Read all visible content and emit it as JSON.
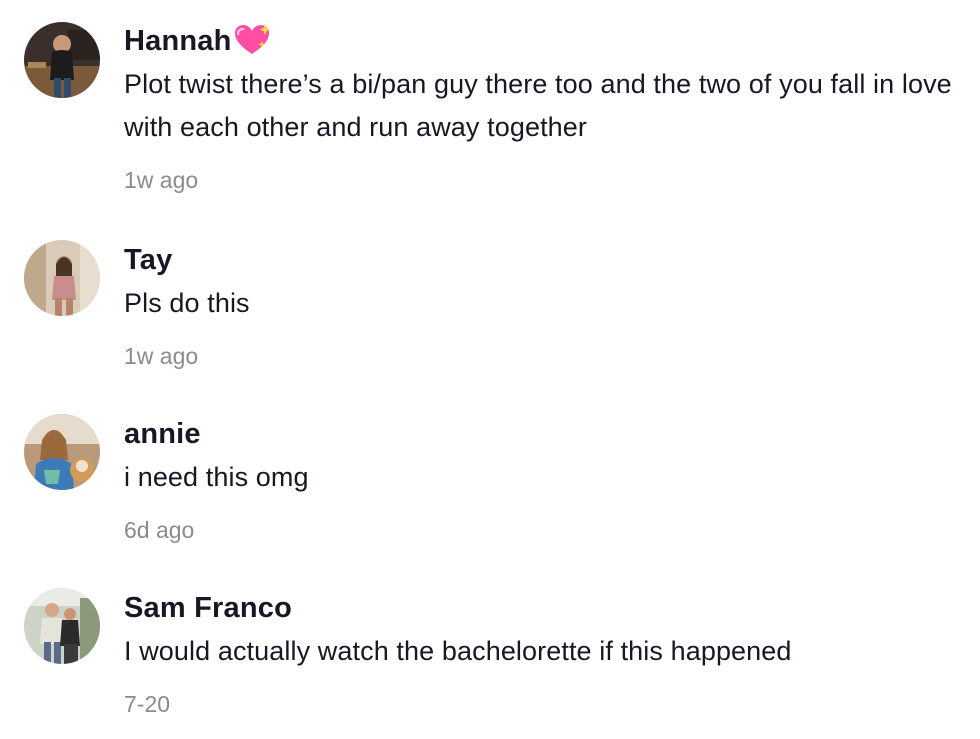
{
  "comments": [
    {
      "username": "Hannah",
      "emoji_icon": "sparkling-heart-icon",
      "text": "Plot twist there’s a bi/pan guy there too and the two of you fall in love with each other and run away together",
      "time": "1w ago"
    },
    {
      "username": "Tay",
      "text": "Pls do this",
      "time": "1w ago"
    },
    {
      "username": "annie",
      "text": "i need this omg",
      "time": "6d ago"
    },
    {
      "username": "Sam Franco",
      "text": "I would actually watch the bachelorette if this happened",
      "time": "7-20"
    }
  ],
  "colors": {
    "text": "#161823",
    "timestamp": "#8a8b91",
    "heart": "#ff4fa3"
  }
}
